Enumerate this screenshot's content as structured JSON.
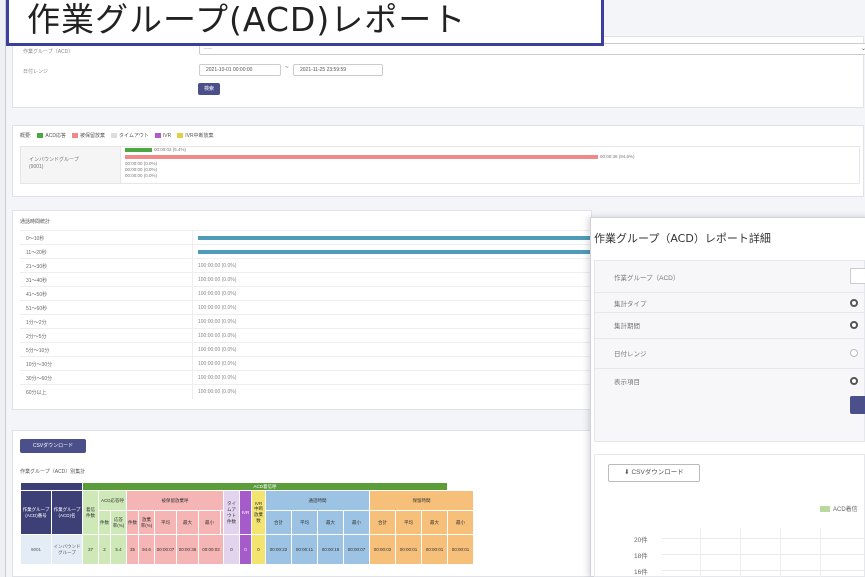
{
  "banner": {
    "title": "作業グループ(ACD)レポート"
  },
  "filter": {
    "group_label": "作業グループ（ACD）",
    "group_value": "-----",
    "date_label": "日付レンジ",
    "date_from": "2021-10-01 00:00:00",
    "date_to": "2021-11-25 23:59:59",
    "search_button": "検索"
  },
  "summary": {
    "legend": [
      {
        "label": "概要:",
        "color": ""
      },
      {
        "label": "ACD応答",
        "color": "#4aa843"
      },
      {
        "label": "被保留放棄",
        "color": "#f08a8a"
      },
      {
        "label": "タイムアウト",
        "color": "#dddddd"
      },
      {
        "label": "IVR",
        "color": "#b05bc9"
      },
      {
        "label": "IVR中断放棄",
        "color": "#e3cd45"
      }
    ],
    "row_label_1": "インバウンドグループ",
    "row_label_2": "(9001)",
    "bar_texts": [
      "00:00:02 (5.4%)",
      "00:00:00 (0.0%)",
      "00:00:00 (0.0%)",
      "00:00:00 (0.0%)"
    ],
    "big_bar_text": "00:00:36 (94.6%)",
    "green_fraction": 0.054,
    "red_fraction": 0.946
  },
  "histogram": {
    "title": "通話時間統計",
    "rows": [
      {
        "label": "0～10秒",
        "value": "",
        "fraction": 1.0
      },
      {
        "label": "11～20秒",
        "value": "",
        "fraction": 1.0
      },
      {
        "label": "21～30秒",
        "value": "100:00:00 (0.0%)",
        "fraction": 0
      },
      {
        "label": "31～40秒",
        "value": "100:00:00 (0.0%)",
        "fraction": 0
      },
      {
        "label": "41～50秒",
        "value": "100:00:00 (0.0%)",
        "fraction": 0
      },
      {
        "label": "51～60秒",
        "value": "100:00:00 (0.0%)",
        "fraction": 0
      },
      {
        "label": "1分～2分",
        "value": "100:00:00 (0.0%)",
        "fraction": 0
      },
      {
        "label": "2分～5分",
        "value": "100:00:00 (0.0%)",
        "fraction": 0
      },
      {
        "label": "5分～10分",
        "value": "100:00:00 (0.0%)",
        "fraction": 0
      },
      {
        "label": "10分～30分",
        "value": "100:00:00 (0.0%)",
        "fraction": 0
      },
      {
        "label": "30分～60分",
        "value": "100:00:00 (0.0%)",
        "fraction": 0
      },
      {
        "label": "60分以上",
        "value": "100:00:00 (0.0%)",
        "fraction": 0
      }
    ]
  },
  "table_section": {
    "csv_button": "CSVダウンロード",
    "title": "作業グループ（ACD）別集計",
    "acd_header": "ACD着信呼",
    "headers": {
      "group_no": "作業グループ(ACD)番号",
      "group_name": "作業グループ(ACD)名",
      "incoming": "着信件数",
      "answered": "ACD応答呼",
      "abandoned": "被保留放棄呼",
      "timeout": "タイムアウト件数",
      "ivr": "IVR",
      "ivr_abandon": "IVR中断放棄数",
      "talk_time": "通話時間",
      "hold_time": "保留時間",
      "other": "発信件数",
      "count": "件数",
      "rate": "応答率(%)",
      "abandon_rate": "放棄率(%)",
      "total": "合計",
      "avg": "平均",
      "max": "最大",
      "min": "最小"
    },
    "row": [
      "9001",
      "インバウンドグループ",
      "37",
      "2",
      "5.4",
      "35",
      "94.6",
      "00:00:07",
      "00:00:36",
      "00:00:02",
      "0",
      "0",
      "0",
      "00:00:22",
      "00:00:11",
      "00:00:19",
      "00:00:07",
      "00:00:02",
      "00:00:01",
      "00:00:01",
      "00:00:01",
      "0",
      "0",
      "0"
    ]
  },
  "detail": {
    "title": "作業グループ（ACD）レポート詳細",
    "labels": [
      "作業グループ（ACD）",
      "集計タイプ",
      "集計期間",
      "日付レンジ",
      "表示項目"
    ],
    "csv_button": "CSVダウンロード",
    "legend_label": "ACD着信",
    "y_ticks": [
      "20件",
      "18件",
      "16件"
    ]
  }
}
